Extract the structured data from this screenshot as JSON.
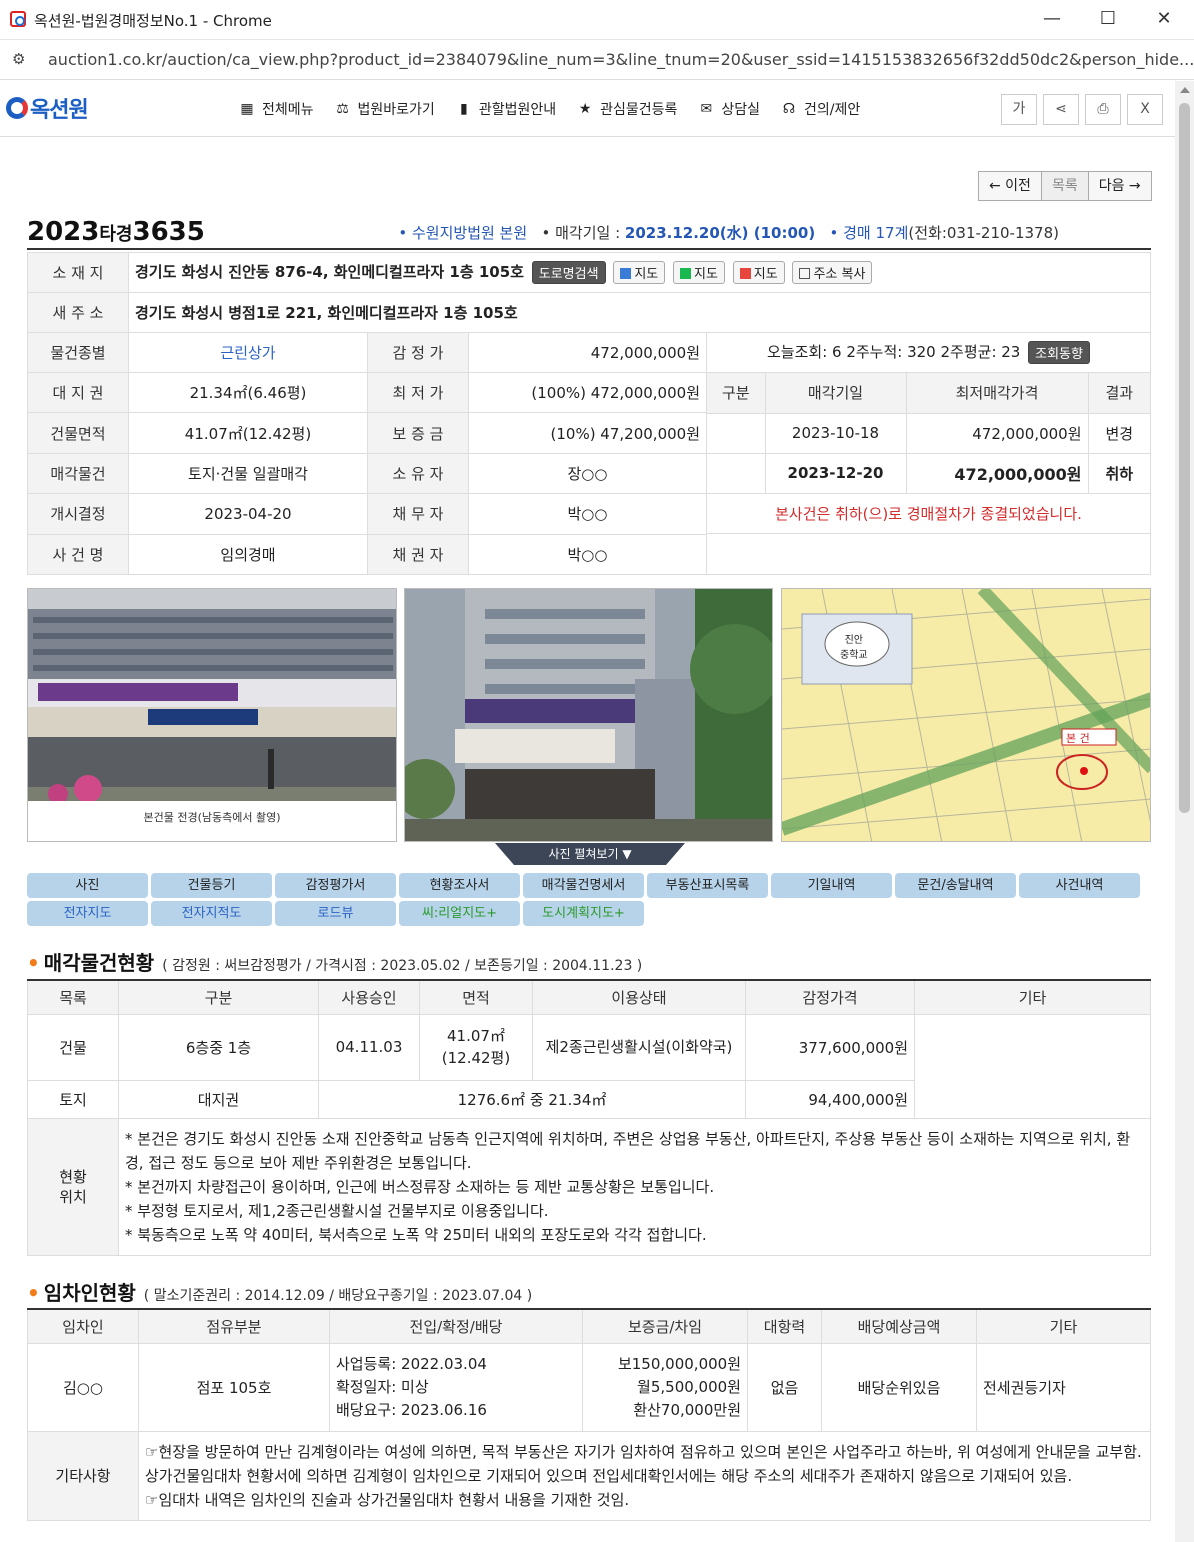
{
  "window": {
    "title": "옥션원-법원경매정보No.1 - Chrome",
    "url": "auction1.co.kr/auction/ca_view.php?product_id=2384079&line_num=3&line_tnum=20&user_ssid=1415153832656f32dd50dc2&person_hide..."
  },
  "nav": {
    "logo": "옥션원",
    "menu": [
      "전체메뉴",
      "법원바로가기",
      "관할법원안내",
      "관심물건등록",
      "상담실",
      "건의/제안"
    ],
    "tools": [
      "가",
      "share",
      "print",
      "X"
    ]
  },
  "pager": {
    "prev": "← 이전",
    "list": "목록",
    "next": "다음 →"
  },
  "case": {
    "year": "2023",
    "kind": "타경",
    "num": "3635",
    "court": "• 수원지방법원 본원",
    "date_label": "• 매각기일 : ",
    "date": "2023.12.20(水) (10:00)",
    "dept": "• 경매 17계",
    "phone": "(전화:031-210-1378)"
  },
  "summary": {
    "address_label": "소 재 지",
    "address": "경기도 화성시 진안동 876-4, 화인메디컬프라자 1층 105호",
    "addr_buttons": [
      "도로명검색",
      "지도",
      "지도",
      "지도",
      "주소 복사"
    ],
    "new_address_label": "새 주 소",
    "new_address": "경기도 화성시 병점1로 221, 화인메디컬프라자 1층 105호",
    "rows": [
      {
        "l1": "물건종별",
        "v1": "근린상가",
        "l2": "감 정 가",
        "v2": "472,000,000원"
      },
      {
        "l1": "대 지 권",
        "v1": "21.34㎡(6.46평)",
        "l2": "최 저 가",
        "v2": "(100%) 472,000,000원"
      },
      {
        "l1": "건물면적",
        "v1": "41.07㎡(12.42평)",
        "l2": "보 증 금",
        "v2": "(10%) 47,200,000원"
      },
      {
        "l1": "매각물건",
        "v1": "토지·건물 일괄매각",
        "l2": "소 유 자",
        "v2": "장○○"
      },
      {
        "l1": "개시결정",
        "v1": "2023-04-20",
        "l2": "채 무 자",
        "v2": "박○○"
      },
      {
        "l1": "사 건 명",
        "v1": "임의경매",
        "l2": "채 권 자",
        "v2": "박○○"
      }
    ],
    "views": "오늘조회: 6  2주누적: 320  2주평균: 23",
    "views_btn": "조회동향",
    "hist_headers": [
      "구분",
      "매각기일",
      "최저매각가격",
      "결과"
    ],
    "hist": [
      {
        "kind": "",
        "date": "2023-10-18",
        "price": "472,000,000원",
        "result": "변경"
      },
      {
        "kind": "",
        "date": "2023-12-20",
        "price": "472,000,000원",
        "result": "취하"
      }
    ],
    "notice": "본사건은 취하(으)로 경매절차가 종결되었습니다."
  },
  "photos": {
    "cap1": "본건물 전경(남동측에서 촬영)",
    "map_school": "진안\n중학교",
    "map_mark": "본 건",
    "fold": "사진 펼쳐보기"
  },
  "tabs": {
    "row1": [
      "사진",
      "건물등기",
      "감정평가서",
      "현황조사서",
      "매각물건명세서",
      "부동산표시목록",
      "기일내역",
      "문건/송달내역",
      "사건내역"
    ],
    "row2": [
      "전자지도",
      "전자지적도",
      "로드뷰",
      "씨:리얼지도+",
      "도시계획지도+"
    ]
  },
  "sale_section": {
    "title": "매각물건현황",
    "sub": "( 감정원 : 써브감정평가 / 가격시점 : 2023.05.02 / 보존등기일 : 2004.11.23 )",
    "headers": [
      "목록",
      "구분",
      "사용승인",
      "면적",
      "이용상태",
      "감정가격",
      "기타"
    ],
    "building": {
      "kind": "건물",
      "floor": "6층중 1층",
      "approved": "04.11.03",
      "area": "41.07㎡\n(12.42평)",
      "use": "제2종근린생활시설(이화약국)",
      "price": "377,600,000원"
    },
    "land": {
      "kind": "토지",
      "type": "대지권",
      "area": "1276.6㎡ 중 21.34㎡",
      "price": "94,400,000원"
    },
    "loc_label": "현황\n위치",
    "notes": [
      "* 본건은 경기도 화성시 진안동 소재 진안중학교 남동측 인근지역에 위치하며, 주변은 상업용 부동산, 아파트단지, 주상용 부동산 등이 소재하는 지역으로 위치, 환경, 접근 정도 등으로 보아 제반 주위환경은 보통입니다.",
      "* 본건까지 차량접근이 용이하며, 인근에 버스정류장 소재하는 등 제반 교통상황은 보통입니다.",
      "* 부정형 토지로서, 제1,2종근린생활시설 건물부지로 이용중입니다.",
      "* 북동측으로 노폭 약 40미터, 북서측으로 노폭 약 25미터 내외의 포장도로와 각각 접합니다."
    ]
  },
  "tenant_section": {
    "title": "임차인현황",
    "sub": "( 말소기준권리 : 2014.12.09 / 배당요구종기일 : 2023.07.04 )",
    "headers": [
      "임차인",
      "점유부분",
      "전입/확정/배당",
      "보증금/차임",
      "대항력",
      "배당예상금액",
      "기타"
    ],
    "row": {
      "name": "김○○",
      "part": "점포 105호",
      "dates": [
        "사업등록: 2022.03.04",
        "확정일자: 미상",
        "배당요구: 2023.06.16"
      ],
      "money": [
        "보150,000,000원",
        "월5,500,000원",
        "환산70,000만원"
      ],
      "oppose": "없음",
      "dividend": "배당순위있음",
      "etc": "전세권등기자"
    },
    "etc_label": "기타사항",
    "etc_notes": [
      "☞현장을 방문하여 만난 김계형이라는 여성에 의하면, 목적 부동산은 자기가 임차하여 점유하고 있으며 본인은 사업주라고 하는바, 위 여성에게 안내문을 교부함. 상가건물임대차 현황서에 의하면 김계형이 임차인으로 기재되어 있으며 전입세대확인서에는 해당 주소의 세대주가 존재하지 않음으로 기재되어 있음.",
      "☞임대차 내역은 임차인의 진술과 상가건물임대차 현황서 내용을 기재한 것임."
    ]
  }
}
